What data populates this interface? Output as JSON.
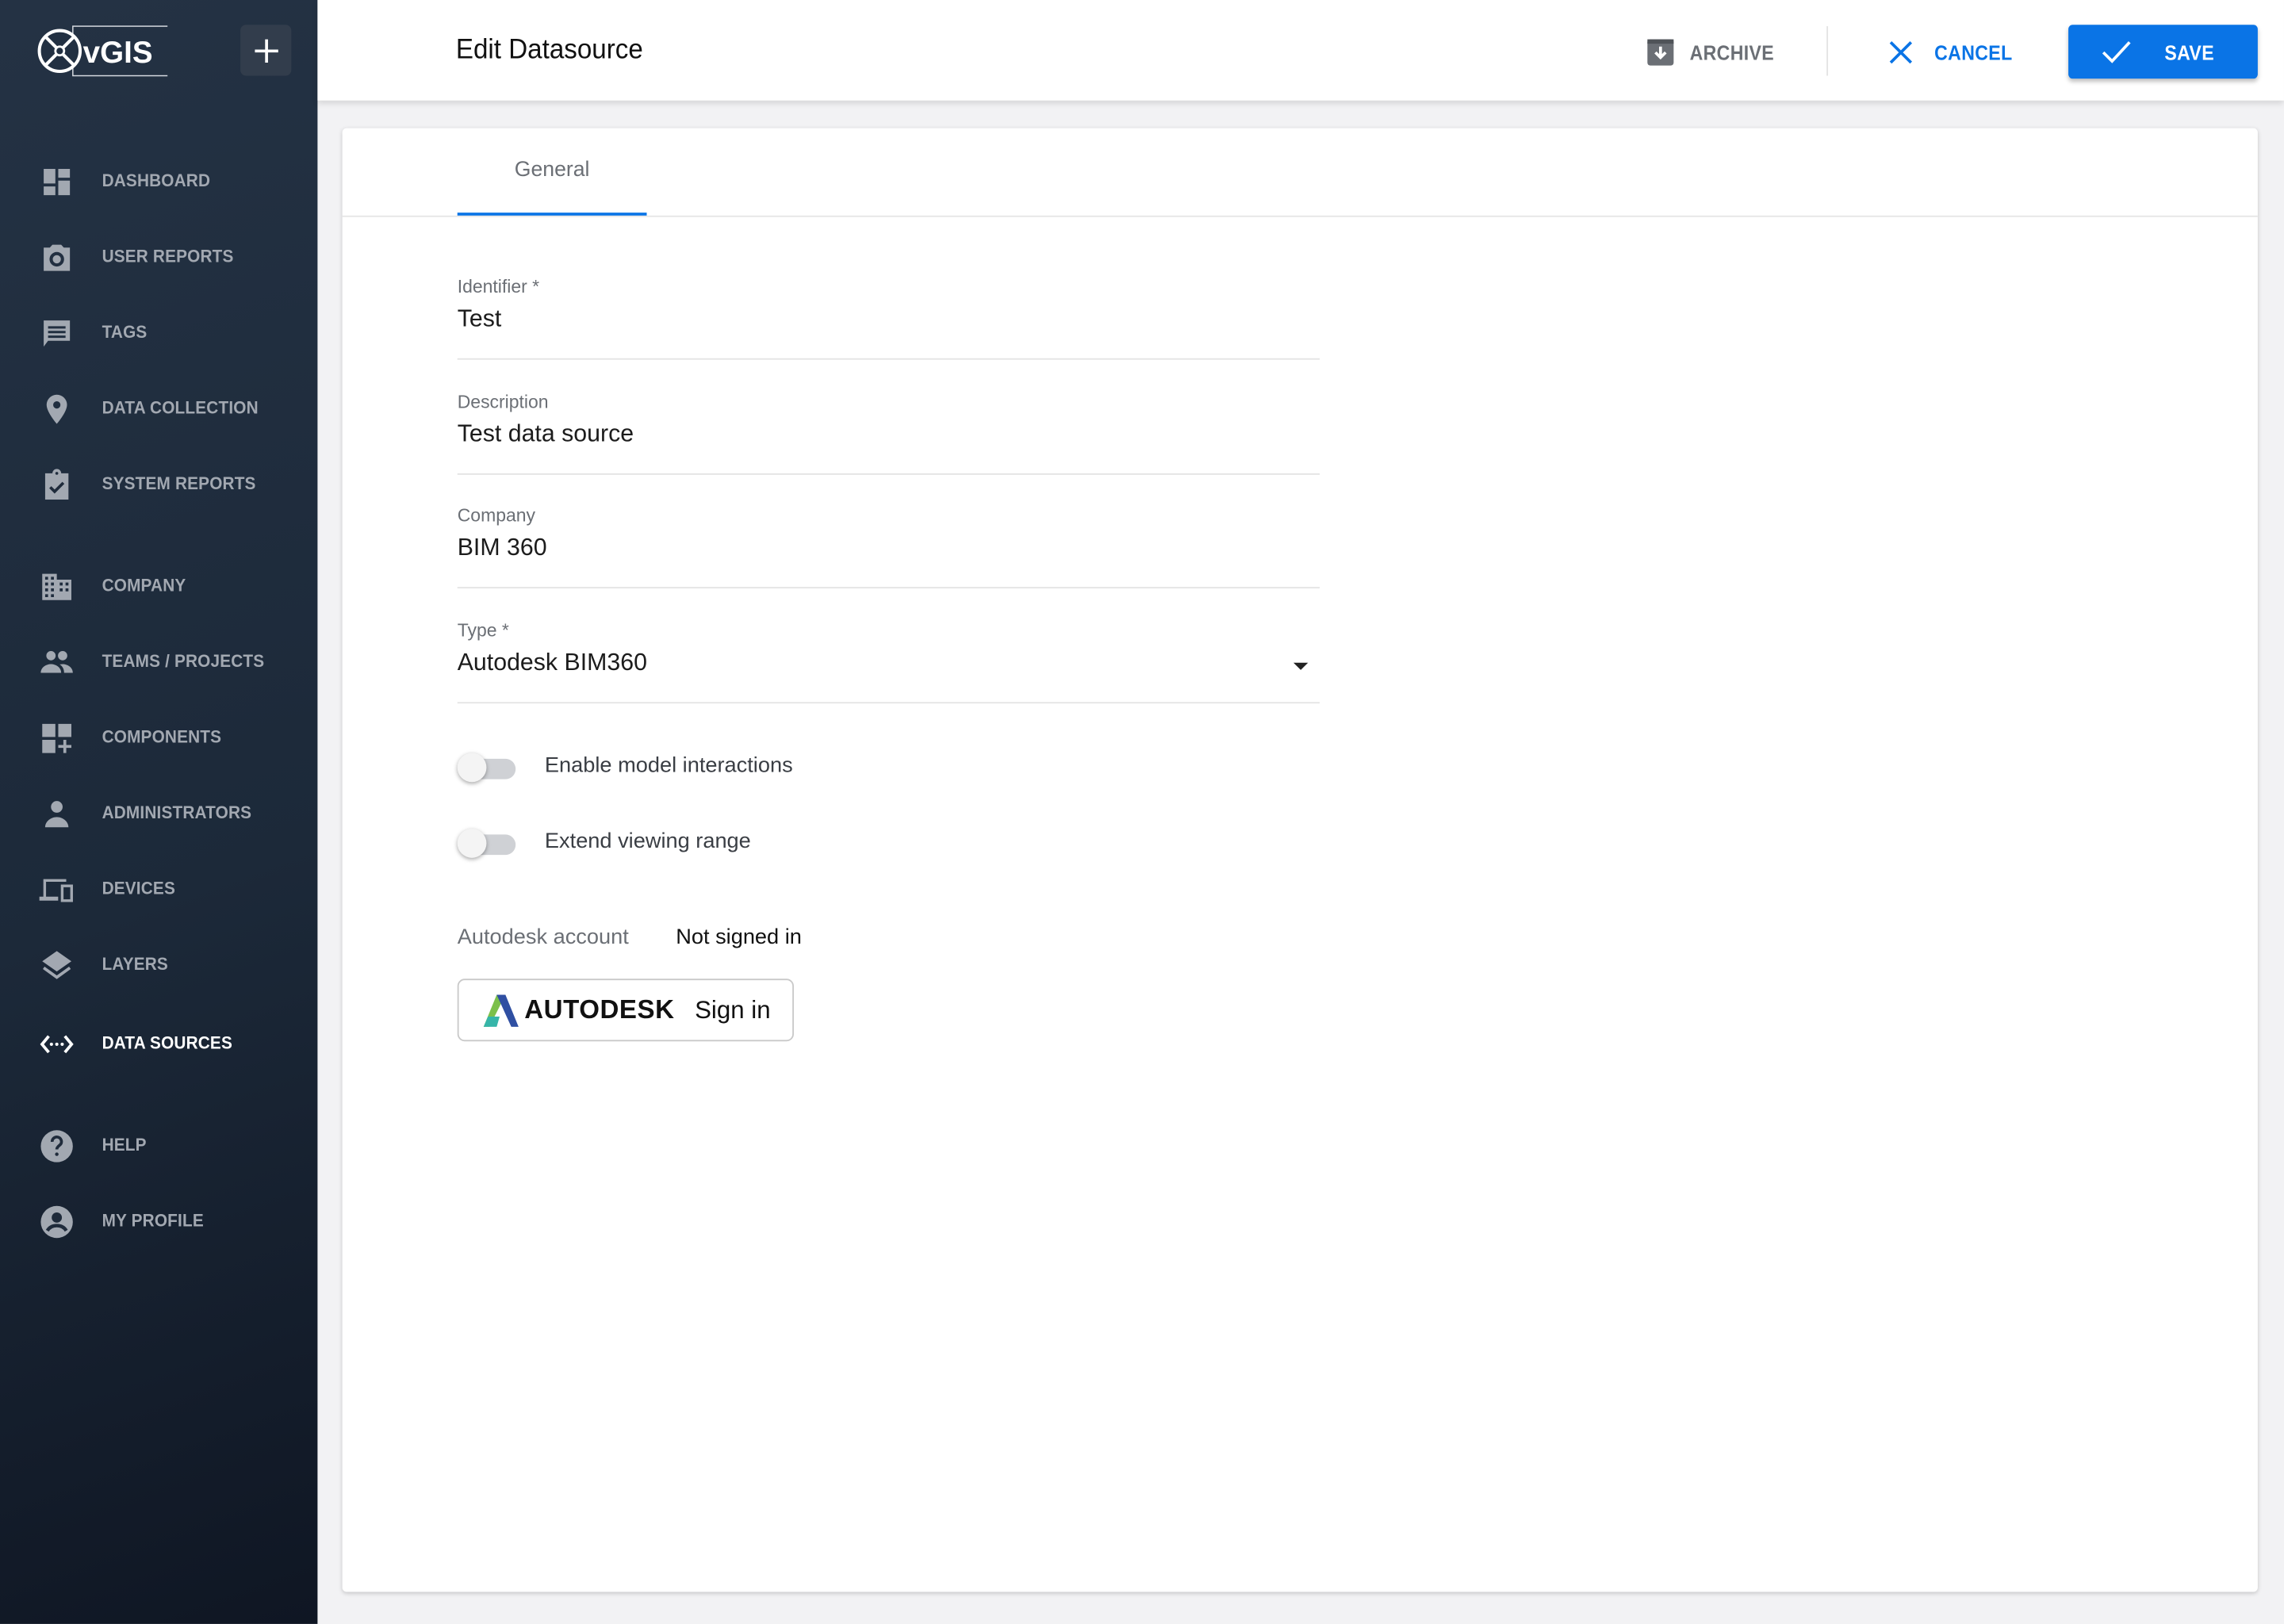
{
  "app": {
    "logo_text": "vGIS"
  },
  "sidebar": {
    "add_icon": "plus-icon",
    "items": [
      {
        "label": "DASHBOARD",
        "icon": "dashboard-icon",
        "active": false
      },
      {
        "label": "USER REPORTS",
        "icon": "camera-icon",
        "active": false
      },
      {
        "label": "TAGS",
        "icon": "comment-icon",
        "active": false
      },
      {
        "label": "DATA COLLECTION",
        "icon": "location-pin-icon",
        "active": false
      },
      {
        "label": "SYSTEM REPORTS",
        "icon": "clipboard-check-icon",
        "active": false
      },
      {
        "label": "COMPANY",
        "icon": "building-icon",
        "active": false
      },
      {
        "label": "TEAMS / PROJECTS",
        "icon": "people-icon",
        "active": false
      },
      {
        "label": "COMPONENTS",
        "icon": "widgets-add-icon",
        "active": false
      },
      {
        "label": "ADMINISTRATORS",
        "icon": "person-icon",
        "active": false
      },
      {
        "label": "DEVICES",
        "icon": "devices-icon",
        "active": false
      },
      {
        "label": "LAYERS",
        "icon": "layers-icon",
        "active": false
      },
      {
        "label": "DATA SOURCES",
        "icon": "settings-ethernet-icon",
        "active": true
      },
      {
        "label": "HELP",
        "icon": "help-icon",
        "active": false
      },
      {
        "label": "MY PROFILE",
        "icon": "account-circle-icon",
        "active": false
      }
    ]
  },
  "header": {
    "title": "Edit Datasource",
    "archive_label": "ARCHIVE",
    "cancel_label": "CANCEL",
    "save_label": "SAVE"
  },
  "tabs": [
    {
      "label": "General",
      "active": true
    }
  ],
  "form": {
    "identifier": {
      "label": "Identifier *",
      "value": "Test"
    },
    "description": {
      "label": "Description",
      "value": "Test data source"
    },
    "company": {
      "label": "Company",
      "value": "BIM 360"
    },
    "type": {
      "label": "Type *",
      "value": "Autodesk BIM360"
    },
    "toggles": [
      {
        "label": "Enable model interactions",
        "on": false
      },
      {
        "label": "Extend viewing range",
        "on": false
      }
    ],
    "account": {
      "label": "Autodesk account",
      "status": "Not signed in"
    },
    "signin": {
      "brand": "AUTODESK",
      "label": "Sign in"
    }
  },
  "colors": {
    "accent": "#0a74e6",
    "sidebar_bg": "#1f2b3b",
    "sidebar_text": "#a2a8b1"
  }
}
